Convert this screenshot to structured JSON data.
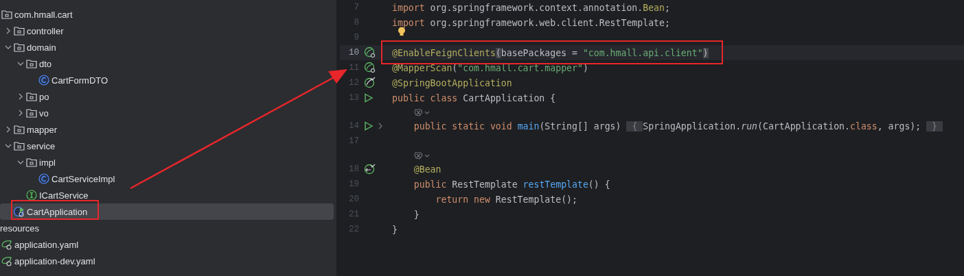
{
  "project_tree": [
    {
      "label": "com.hmall.cart",
      "kind": "package",
      "selected": false,
      "children": [
        {
          "label": "controller",
          "kind": "package",
          "expanded": false,
          "selected": false
        },
        {
          "label": "domain",
          "kind": "package",
          "expanded": true,
          "selected": false,
          "children": [
            {
              "label": "dto",
              "kind": "package",
              "expanded": true,
              "selected": false,
              "children": [
                {
                  "label": "CartFormDTO",
                  "kind": "class",
                  "selected": false
                }
              ]
            },
            {
              "label": "po",
              "kind": "package",
              "expanded": false,
              "selected": false
            },
            {
              "label": "vo",
              "kind": "package",
              "expanded": false,
              "selected": false
            }
          ]
        },
        {
          "label": "mapper",
          "kind": "package",
          "expanded": false,
          "selected": false
        },
        {
          "label": "service",
          "kind": "package",
          "expanded": true,
          "selected": false,
          "children": [
            {
              "label": "impl",
              "kind": "package",
              "expanded": true,
              "selected": false,
              "children": [
                {
                  "label": "CartServiceImpl",
                  "kind": "class",
                  "selected": false
                }
              ]
            },
            {
              "label": "ICartService",
              "kind": "interface",
              "selected": false
            }
          ]
        },
        {
          "label": "CartApplication",
          "kind": "app",
          "selected": true
        }
      ]
    },
    {
      "label": "resources",
      "kind": "source-root",
      "selected": false,
      "children": [
        {
          "label": "application.yaml",
          "kind": "yaml",
          "selected": false
        },
        {
          "label": "application-dev.yaml",
          "kind": "yaml",
          "selected": false
        }
      ]
    }
  ],
  "editor": {
    "lines": [
      {
        "kind": "code",
        "number": "7",
        "bulb": false,
        "current": false,
        "tokens": [
          {
            "t": "import ",
            "kind": "keyword"
          },
          {
            "t": "org.springframework.context.annotation.",
            "kind": "plain"
          },
          {
            "t": "Bean",
            "kind": "annotation"
          },
          {
            "t": ";",
            "kind": "plain"
          }
        ]
      },
      {
        "kind": "code",
        "number": "8",
        "bulb": false,
        "current": false,
        "tokens": [
          {
            "t": "import ",
            "kind": "keyword"
          },
          {
            "t": "org.springframework.web.client.RestTemplate;",
            "kind": "plain"
          }
        ]
      },
      {
        "kind": "code",
        "number": "9",
        "bulb": true,
        "current": false
      },
      {
        "kind": "code",
        "number": "10",
        "gutter_icon": {
          "kind": "bean-nav"
        },
        "bulb": false,
        "current": true,
        "tokens": [
          {
            "t": "@EnableFeignClients",
            "kind": "annotation"
          },
          {
            "t": "(",
            "kind": "match"
          },
          {
            "t": "basePackages = ",
            "kind": "plain"
          },
          {
            "t": "\"com.hmall.api.client\"",
            "kind": "string"
          },
          {
            "t": ")",
            "kind": "match"
          }
        ]
      },
      {
        "kind": "code",
        "number": "11",
        "gutter_icon": {
          "kind": "bean-nav"
        },
        "bulb": false,
        "current": false,
        "tokens": [
          {
            "t": "@MapperScan",
            "kind": "annotation"
          },
          {
            "t": "(",
            "kind": "plain"
          },
          {
            "t": "\"com.hmall.cart.mapper\"",
            "kind": "string"
          },
          {
            "t": ")",
            "kind": "plain"
          }
        ]
      },
      {
        "kind": "code",
        "number": "12",
        "gutter_icon": {
          "kind": "spring"
        },
        "bulb": false,
        "current": false,
        "tokens": [
          {
            "t": "@SpringBootApplication",
            "kind": "annotation"
          }
        ]
      },
      {
        "kind": "code",
        "number": "13",
        "gutter_icon": {
          "kind": "run"
        },
        "bulb": false,
        "current": false,
        "tokens": [
          {
            "t": "public class ",
            "kind": "keyword"
          },
          {
            "t": "CartApplication {",
            "kind": "plain"
          }
        ]
      },
      {
        "kind": "hint"
      },
      {
        "kind": "code",
        "number": "14",
        "gutter_icon": {
          "kind": "run-fold"
        },
        "bulb": false,
        "current": false,
        "tokens": [
          {
            "t": "    public static void ",
            "kind": "keyword"
          },
          {
            "t": "main",
            "kind": "method"
          },
          {
            "t": "(String[] args) ",
            "kind": "plain"
          },
          {
            "t": " { ",
            "kind": "fold"
          },
          {
            "t": "SpringApplication.",
            "kind": "plain"
          },
          {
            "t": "run",
            "kind": "italic"
          },
          {
            "t": "(CartApplication.",
            "kind": "plain"
          },
          {
            "t": "class",
            "kind": "keyword"
          },
          {
            "t": ", args); ",
            "kind": "plain"
          },
          {
            "t": " } ",
            "kind": "fold"
          }
        ]
      },
      {
        "kind": "code",
        "number": "17",
        "bulb": false,
        "current": false
      },
      {
        "kind": "hint"
      },
      {
        "kind": "code",
        "number": "18",
        "gutter_icon": {
          "kind": "bean"
        },
        "bulb": false,
        "current": false,
        "tokens": [
          {
            "t": "    @Bean",
            "kind": "annotation"
          }
        ]
      },
      {
        "kind": "code",
        "number": "19",
        "bulb": false,
        "current": false,
        "tokens": [
          {
            "t": "    public ",
            "kind": "keyword"
          },
          {
            "t": "RestTemplate ",
            "kind": "plain"
          },
          {
            "t": "restTemplate",
            "kind": "method"
          },
          {
            "t": "() {",
            "kind": "plain"
          }
        ]
      },
      {
        "kind": "code",
        "number": "20",
        "bulb": false,
        "current": false,
        "tokens": [
          {
            "t": "        return new ",
            "kind": "keyword"
          },
          {
            "t": "RestTemplate();",
            "kind": "plain"
          }
        ]
      },
      {
        "kind": "code",
        "number": "21",
        "bulb": false,
        "current": false,
        "tokens": [
          {
            "t": "    }",
            "kind": "plain"
          }
        ]
      },
      {
        "kind": "code",
        "number": "22",
        "bulb": false,
        "current": false,
        "tokens": [
          {
            "t": "}",
            "kind": "plain"
          }
        ]
      }
    ]
  }
}
